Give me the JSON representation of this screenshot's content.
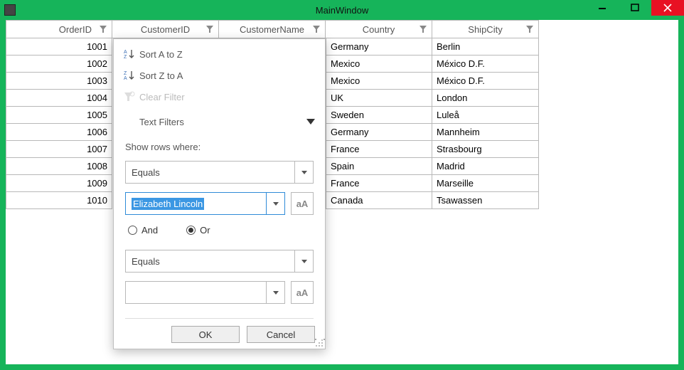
{
  "window": {
    "title": "MainWindow"
  },
  "columns": {
    "orderid": "OrderID",
    "customerid": "CustomerID",
    "customername": "CustomerName",
    "country": "Country",
    "shipcity": "ShipCity"
  },
  "orders": [
    "1001",
    "1002",
    "1003",
    "1004",
    "1005",
    "1006",
    "1007",
    "1008",
    "1009",
    "1010"
  ],
  "rows": [
    {
      "country": "Germany",
      "shipcity": "Berlin"
    },
    {
      "country": "Mexico",
      "shipcity": "México D.F."
    },
    {
      "country": "Mexico",
      "shipcity": "México D.F."
    },
    {
      "country": "UK",
      "shipcity": "London"
    },
    {
      "country": "Sweden",
      "shipcity": "Luleå"
    },
    {
      "country": "Germany",
      "shipcity": "Mannheim"
    },
    {
      "country": "France",
      "shipcity": "Strasbourg"
    },
    {
      "country": "Spain",
      "shipcity": "Madrid"
    },
    {
      "country": "France",
      "shipcity": "Marseille"
    },
    {
      "country": "Canada",
      "shipcity": "Tsawassen"
    }
  ],
  "popup": {
    "sort_asc": "Sort A to Z",
    "sort_desc": "Sort Z to A",
    "clear": "Clear Filter",
    "text_filters": "Text Filters",
    "show_rows": "Show rows where:",
    "op1": "Equals",
    "val1": "Elizabeth Lincoln",
    "and": "And",
    "or": "Or",
    "op2": "Equals",
    "val2": "",
    "aa": "aA",
    "ok": "OK",
    "cancel": "Cancel"
  }
}
